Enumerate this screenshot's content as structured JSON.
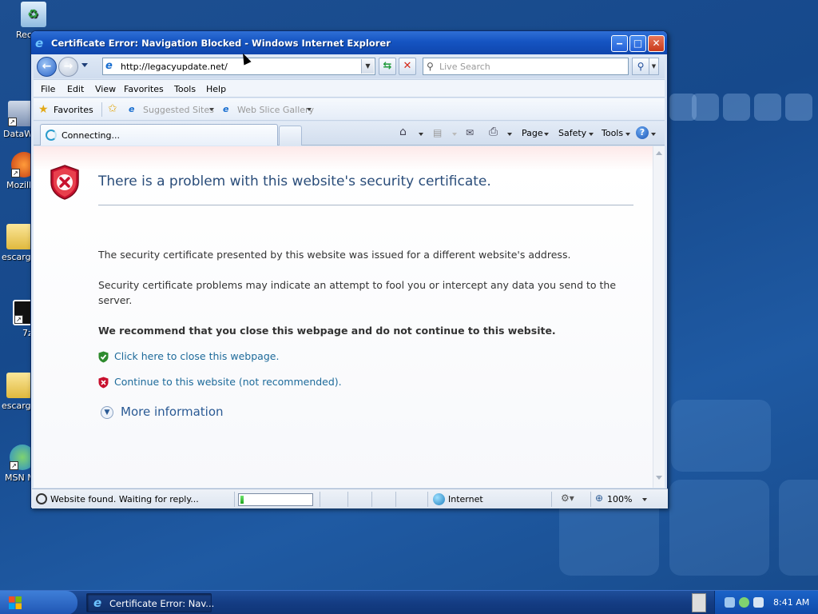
{
  "desktop": {
    "icons": [
      {
        "label": "Rec",
        "icon": "recycle-bin-icon"
      },
      {
        "label": "DataW",
        "icon": "datawell-shortcut-icon"
      },
      {
        "label": "Mozill",
        "icon": "mozilla-shortcut-icon"
      },
      {
        "label": "escargo",
        "icon": "folder-zip-icon"
      },
      {
        "label": "7z",
        "icon": "7zip-shortcut-icon"
      },
      {
        "label": "escargo",
        "icon": "folder-icon"
      },
      {
        "label": "MSN M",
        "icon": "msn-messenger-shortcut-icon"
      }
    ]
  },
  "window": {
    "title": "Certificate Error: Navigation Blocked - Windows Internet Explorer",
    "controls": {
      "minimize": "‒",
      "maximize": "□",
      "close": "✕"
    }
  },
  "addressbar": {
    "url": "http://legacyupdate.net/",
    "search_placeholder": "Live Search"
  },
  "menubar": {
    "items": [
      "File",
      "Edit",
      "View",
      "Favorites",
      "Tools",
      "Help"
    ]
  },
  "favorites": {
    "label": "Favorites",
    "links": [
      "Suggested Sites",
      "Web Slice Gallery"
    ]
  },
  "tabs": {
    "active_title": "Connecting..."
  },
  "commandbar": {
    "page": "Page",
    "safety": "Safety",
    "tools": "Tools"
  },
  "content": {
    "title": "There is a problem with this website's security certificate.",
    "para1": "The security certificate presented by this website was issued for a different website's address.",
    "para2": "Security certificate problems may indicate an attempt to fool you or intercept any data you send to the server.",
    "recommend": "We recommend that you close this webpage and do not continue to this website.",
    "close_link": "Click here to close this webpage.",
    "continue_link": "Continue to this website (not recommended).",
    "more_info": "More information"
  },
  "statusbar": {
    "text": "Website found. Waiting for reply...",
    "progress": 0.05,
    "zone": "Internet",
    "zoom": "100%"
  },
  "taskbar": {
    "task_label": "Certificate Error: Nav...",
    "clock": "8:41 AM"
  },
  "colors": {
    "title_link": "#2a4d7a",
    "link": "#1d6a9a",
    "error_red": "#c8102e",
    "ok_green": "#2e8b2e"
  }
}
